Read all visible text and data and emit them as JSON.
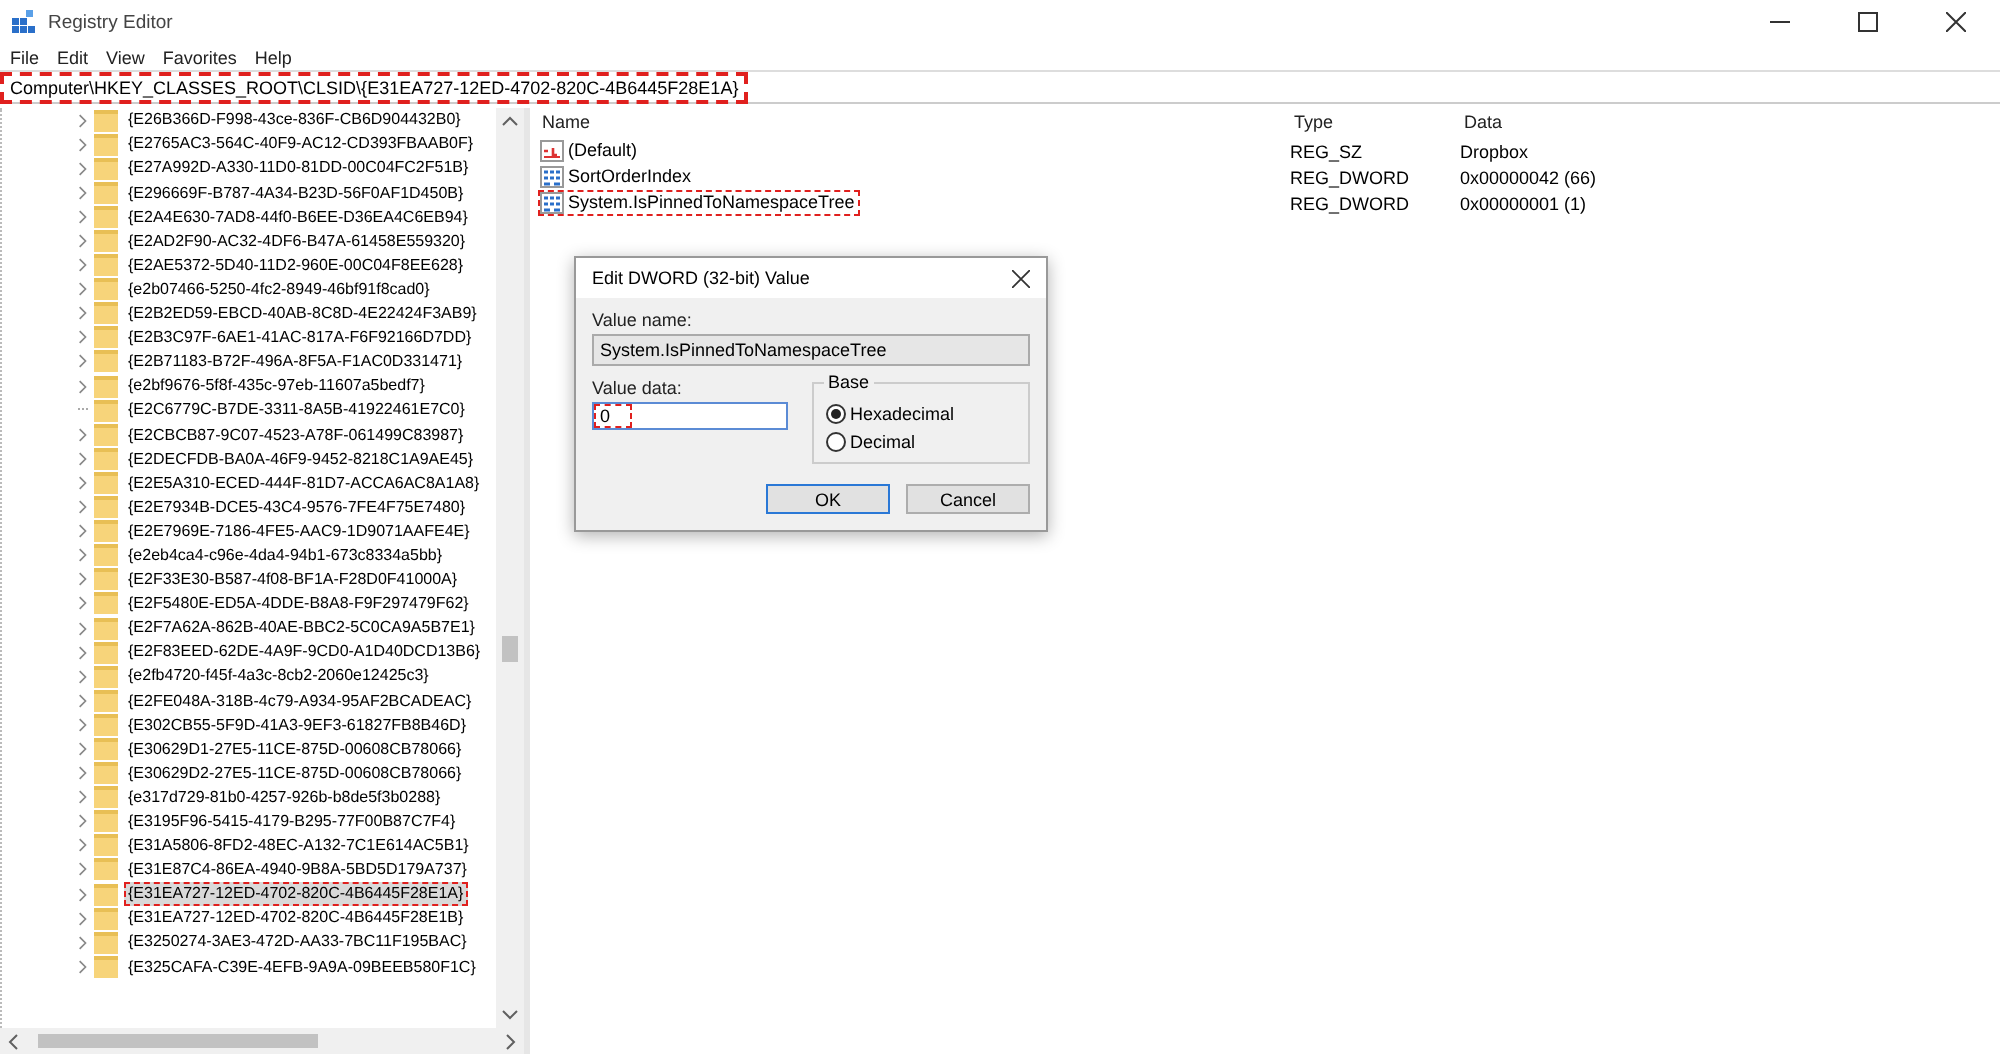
{
  "window": {
    "title": "Registry Editor"
  },
  "menu": [
    "File",
    "Edit",
    "View",
    "Favorites",
    "Help"
  ],
  "address": {
    "value": "Computer\\HKEY_CLASSES_ROOT\\CLSID\\{E31EA727-12ED-4702-820C-4B6445F28E1A}",
    "highlighted": true
  },
  "tree": [
    {
      "label": "{E26B366D-F998-43ce-836F-CB6D904432B0}",
      "expandable": true,
      "selected": false
    },
    {
      "label": "{E2765AC3-564C-40F9-AC12-CD393FBAAB0F}",
      "expandable": true,
      "selected": false
    },
    {
      "label": "{E27A992D-A330-11D0-81DD-00C04FC2F51B}",
      "expandable": true,
      "selected": false
    },
    {
      "label": "{E296669F-B787-4A34-B23D-56F0AF1D450B}",
      "expandable": true,
      "selected": false
    },
    {
      "label": "{E2A4E630-7AD8-44f0-B6EE-D36EA4C6EB94}",
      "expandable": true,
      "selected": false
    },
    {
      "label": "{E2AD2F90-AC32-4DF6-B47A-61458E559320}",
      "expandable": true,
      "selected": false
    },
    {
      "label": "{E2AE5372-5D40-11D2-960E-00C04F8EE628}",
      "expandable": true,
      "selected": false
    },
    {
      "label": "{e2b07466-5250-4fc2-8949-46bf91f8cad0}",
      "expandable": true,
      "selected": false
    },
    {
      "label": "{E2B2ED59-EBCD-40AB-8C8D-4E22424F3AB9}",
      "expandable": true,
      "selected": false
    },
    {
      "label": "{E2B3C97F-6AE1-41AC-817A-F6F92166D7DD}",
      "expandable": true,
      "selected": false
    },
    {
      "label": "{E2B71183-B72F-496A-8F5A-F1AC0D331471}",
      "expandable": true,
      "selected": false
    },
    {
      "label": "{e2bf9676-5f8f-435c-97eb-11607a5bedf7}",
      "expandable": true,
      "selected": false
    },
    {
      "label": "{E2C6779C-B7DE-3311-8A5B-41922461E7C0}",
      "expandable": false,
      "selected": false
    },
    {
      "label": "{E2CBCB87-9C07-4523-A78F-061499C83987}",
      "expandable": true,
      "selected": false
    },
    {
      "label": "{E2DECFDB-BA0A-46F9-9452-8218C1A9AE45}",
      "expandable": true,
      "selected": false
    },
    {
      "label": "{E2E5A310-ECED-444F-81D7-ACCA6AC8A1A8}",
      "expandable": true,
      "selected": false
    },
    {
      "label": "{E2E7934B-DCE5-43C4-9576-7FE4F75E7480}",
      "expandable": true,
      "selected": false
    },
    {
      "label": "{E2E7969E-7186-4FE5-AAC9-1D9071AAFE4E}",
      "expandable": true,
      "selected": false
    },
    {
      "label": "{e2eb4ca4-c96e-4da4-94b1-673c8334a5bb}",
      "expandable": true,
      "selected": false
    },
    {
      "label": "{E2F33E30-B587-4f08-BF1A-F28D0F41000A}",
      "expandable": true,
      "selected": false
    },
    {
      "label": "{E2F5480E-ED5A-4DDE-B8A8-F9F297479F62}",
      "expandable": true,
      "selected": false
    },
    {
      "label": "{E2F7A62A-862B-40AE-BBC2-5C0CA9A5B7E1}",
      "expandable": true,
      "selected": false
    },
    {
      "label": "{E2F83EED-62DE-4A9F-9CD0-A1D40DCD13B6}",
      "expandable": true,
      "selected": false
    },
    {
      "label": "{e2fb4720-f45f-4a3c-8cb2-2060e12425c3}",
      "expandable": true,
      "selected": false
    },
    {
      "label": "{E2FE048A-318B-4c79-A934-95AF2BCADEAC}",
      "expandable": true,
      "selected": false
    },
    {
      "label": "{E302CB55-5F9D-41A3-9EF3-61827FB8B46D}",
      "expandable": true,
      "selected": false
    },
    {
      "label": "{E30629D1-27E5-11CE-875D-00608CB78066}",
      "expandable": true,
      "selected": false
    },
    {
      "label": "{E30629D2-27E5-11CE-875D-00608CB78066}",
      "expandable": true,
      "selected": false
    },
    {
      "label": "{e317d729-81b0-4257-926b-b8de5f3b0288}",
      "expandable": true,
      "selected": false
    },
    {
      "label": "{E3195F96-5415-4179-B295-77F00B87C7F4}",
      "expandable": true,
      "selected": false
    },
    {
      "label": "{E31A5806-8FD2-48EC-A132-7C1E614AC5B1}",
      "expandable": true,
      "selected": false
    },
    {
      "label": "{E31E87C4-86EA-4940-9B8A-5BD5D179A737}",
      "expandable": true,
      "selected": false
    },
    {
      "label": "{E31EA727-12ED-4702-820C-4B6445F28E1A}",
      "expandable": true,
      "selected": true
    },
    {
      "label": "{E31EA727-12ED-4702-820C-4B6445F28E1B}",
      "expandable": true,
      "selected": false
    },
    {
      "label": "{E3250274-3AE3-472D-AA33-7BC11F195BAC}",
      "expandable": true,
      "selected": false
    },
    {
      "label": "{E325CAFA-C39E-4EFB-9A9A-09BEEB580F1C}",
      "expandable": true,
      "selected": false
    }
  ],
  "values": {
    "columns": [
      "Name",
      "Type",
      "Data"
    ],
    "rows": [
      {
        "kind": "string",
        "name": "(Default)",
        "type": "REG_SZ",
        "data": "Dropbox",
        "highlighted": false
      },
      {
        "kind": "binary",
        "name": "SortOrderIndex",
        "type": "REG_DWORD",
        "data": "0x00000042 (66)",
        "highlighted": false
      },
      {
        "kind": "binary",
        "name": "System.IsPinnedToNamespaceTree",
        "type": "REG_DWORD",
        "data": "0x00000001 (1)",
        "highlighted": true
      }
    ]
  },
  "dialog": {
    "title": "Edit DWORD (32-bit) Value",
    "value_name_label": "Value name:",
    "value_name": "System.IsPinnedToNamespaceTree",
    "value_data_label": "Value data:",
    "value_data": "0",
    "value_data_highlighted": true,
    "base_label": "Base",
    "base_options": [
      {
        "label": "Hexadecimal",
        "selected": true
      },
      {
        "label": "Decimal",
        "selected": false
      }
    ],
    "buttons": [
      {
        "label": "OK",
        "default": true
      },
      {
        "label": "Cancel",
        "default": false
      }
    ]
  }
}
